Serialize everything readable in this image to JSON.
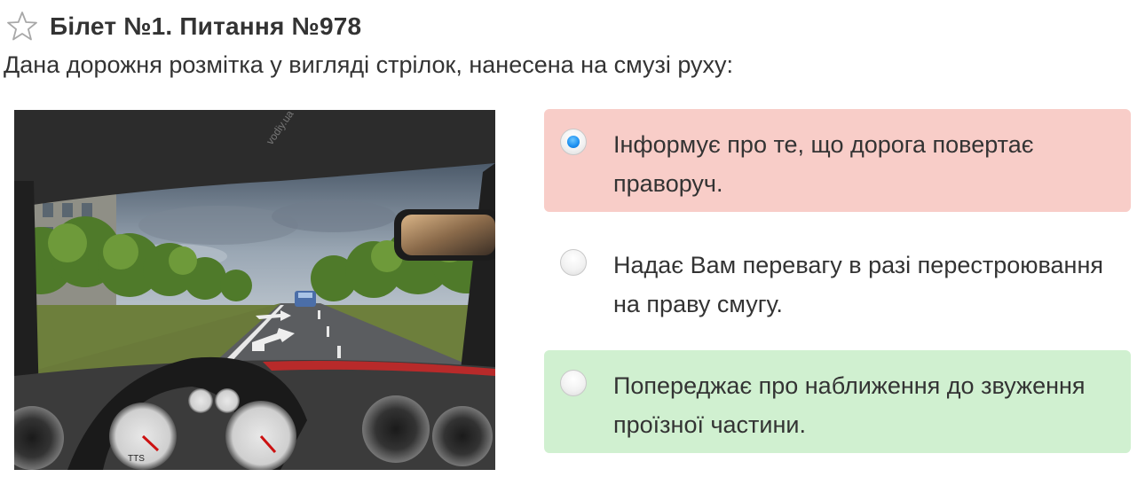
{
  "header": {
    "title": "Білет №1. Питання №978"
  },
  "question": {
    "text": "Дана дорожня розмітка у вигляді стрілок, нанесена на смузі руху:"
  },
  "picture": {
    "watermark": "vodiy.ua",
    "speedometer_badge": "TTS"
  },
  "answers": [
    {
      "text": "Інформує про те, що дорога повертає праворуч.",
      "selected": true,
      "state": "wrong"
    },
    {
      "text": "Надає Вам перевагу в разі перестроювання на праву смугу.",
      "selected": false,
      "state": "neutral"
    },
    {
      "text": "Попереджає про наближення до звуження проїзної частини.",
      "selected": false,
      "state": "correct"
    }
  ],
  "colors": {
    "wrong_bg": "#f8cdc8",
    "correct_bg": "#d0f0d0",
    "radio_selected": "#1a8ef0",
    "text": "#333333"
  },
  "icons": {
    "favorite": "star-outline-icon"
  }
}
